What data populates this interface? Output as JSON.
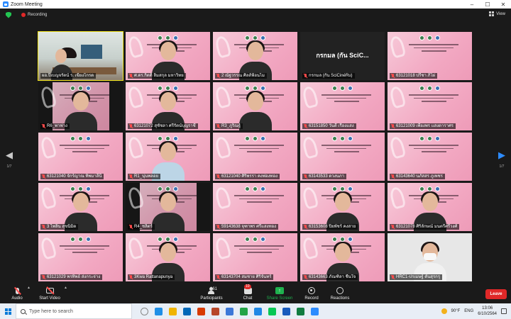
{
  "window": {
    "title": "Zoom Meeting",
    "controls": [
      "–",
      "☐",
      "✕"
    ]
  },
  "status": {
    "recording_label": "Recording",
    "view_label": "View"
  },
  "pager": {
    "left_page": "1/7",
    "right_page": "1/7"
  },
  "tiles": [
    {
      "name": "ผอ.ปีเบญจรัตน์ ร. เขียงโกรด",
      "kind": "room",
      "muted": false,
      "active": true
    },
    {
      "name": "ศ.ดร.กิตติ ลิ้มสกุล มหาวิทย",
      "kind": "slide-person",
      "muted": true
    },
    {
      "name": "2 ณัฐวรรณ ศิลส์ฟ้อนไม",
      "kind": "slide-person-f",
      "muted": true
    },
    {
      "name": "กรกมล (กัน SciCinéRu)",
      "kind": "blank",
      "display_name": "กรกมล (กัน SciC...",
      "muted": true
    },
    {
      "name": "63121018 ปรีชา ภิไผ่",
      "kind": "slide",
      "muted": true
    },
    {
      "name": "R6_พาฟาง",
      "kind": "dark-person",
      "muted": true
    },
    {
      "name": "63121072 สุชัชลา ศรีรัตน์บุญราชี",
      "kind": "slide-person",
      "muted": true
    },
    {
      "name": "R3_ภูริณฐ์",
      "kind": "slide-person",
      "muted": true
    },
    {
      "name": "63151850 วันดี เรืองแสง",
      "kind": "slide",
      "muted": true
    },
    {
      "name": "63121009 เพียงพร แสงดาราศร",
      "kind": "slide",
      "muted": true
    },
    {
      "name": "63121040 จักร์ญาณ ทิพมาลีนี",
      "kind": "slide",
      "muted": true
    },
    {
      "name": "R1_นุ่นพลอย",
      "kind": "slide-person-light",
      "muted": true
    },
    {
      "name": "63121040 ศิริพรรา คงฟองทอง",
      "kind": "slide",
      "muted": true
    },
    {
      "name": "63143533 ดวงนภา",
      "kind": "slide",
      "muted": true
    },
    {
      "name": "63143640 นภัสสร ภูเพชร",
      "kind": "slide",
      "muted": true
    },
    {
      "name": "3 ไพลิน สุขนิมิต",
      "kind": "slide-person-f",
      "muted": true
    },
    {
      "name": "R4_ชลิตร์",
      "kind": "dark-person",
      "muted": true
    },
    {
      "name": "59143638 จุฑาพร ศรีแสงทอง",
      "kind": "slide",
      "muted": true
    },
    {
      "name": "63153608 ปิยพัชร์ คงสาย",
      "kind": "slide-person",
      "muted": true
    },
    {
      "name": "63121078 ศิริลักษณ์ มนตรีศรีวงศ์",
      "kind": "slide-person-f",
      "muted": true
    },
    {
      "name": "63121029 พรทิพย์ ส่งกระจ่าง",
      "kind": "slide",
      "muted": true
    },
    {
      "name": "3Kwa Rattanapunya",
      "kind": "slide-person",
      "muted": true
    },
    {
      "name": "63143704 สมชาย ศิริจันทร์",
      "kind": "slide",
      "muted": true
    },
    {
      "name": "63143663 ภัณฑิลา ชื่นใจ",
      "kind": "slide-person",
      "muted": true
    },
    {
      "name": "HRC1-ปรเมษฐ์ ตันสุรกรุ",
      "kind": "white-person",
      "muted": true
    }
  ],
  "controls": {
    "audio": "Audio",
    "video": "Start Video",
    "participants": "Participants",
    "participants_count": "161",
    "chat": "Chat",
    "chat_badge": "10",
    "share": "Share Screen",
    "record": "Record",
    "reactions": "Reactions",
    "leave": "Leave"
  },
  "taskbar": {
    "search_placeholder": "Type here to search",
    "weather": "90°F",
    "language": "ENG",
    "time": "13:06",
    "date": "6/10/2564",
    "app_colors": [
      "#888888",
      "#1f8fe6",
      "#f0b400",
      "#0068b8",
      "#d83b01",
      "#b7472a",
      "#3b78d8",
      "#22a447",
      "#1e88e5",
      "#06c755",
      "#185abd",
      "#107c41",
      "#2d8cff"
    ]
  },
  "colors": {
    "accent": "#2d8cff",
    "leave": "#e02828",
    "share": "#1fb24e",
    "active_outline": "#f2e41c"
  }
}
